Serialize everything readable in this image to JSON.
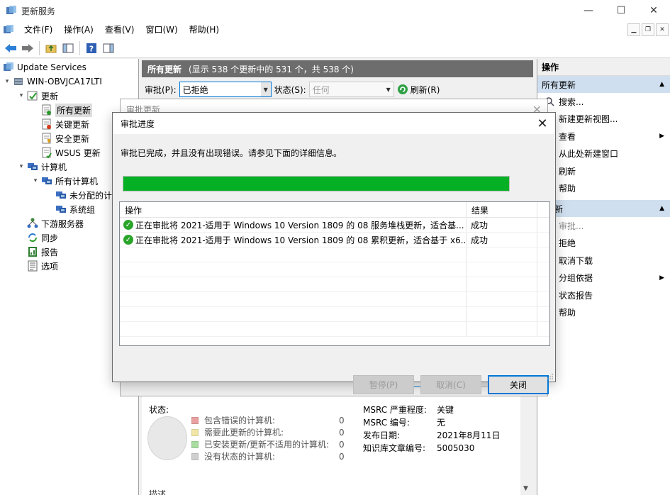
{
  "window": {
    "title": "更新服务"
  },
  "window_buttons": {
    "minimize": "—",
    "maximize": "☐",
    "close": "✕"
  },
  "menu": [
    "文件(F)",
    "操作(A)",
    "查看(V)",
    "窗口(W)",
    "帮助(H)"
  ],
  "tree": {
    "root": "Update Services",
    "server": "WIN-OBVJCA17LTI",
    "updates": "更新",
    "all_updates": "所有更新",
    "critical_updates": "关键更新",
    "security_updates": "安全更新",
    "wsus_updates": "WSUS 更新",
    "computers": "计算机",
    "all_computers": "所有计算机",
    "unassigned": "未分配的计",
    "system_group": "系统组",
    "downstream": "下游服务器",
    "sync": "同步",
    "reports": "报告",
    "options": "选项"
  },
  "center": {
    "header_title": "所有更新",
    "header_count": "(显示 538 个更新中的 531 个，共 538 个)",
    "approval_label": "审批(P):",
    "approval_value": "已拒绝",
    "status_label": "状态(S):",
    "status_value": "任何",
    "refresh_label": "刷新(R)"
  },
  "details": {
    "status_label": "状态:",
    "legend": [
      {
        "label": "包含错误的计算机:",
        "count": "0",
        "color": "#e8a0a0"
      },
      {
        "label": "需要此更新的计算机:",
        "count": "0",
        "color": "#f2e6a6"
      },
      {
        "label": "已安装更新/更新不适用的计算机:",
        "count": "0",
        "color": "#a8dca0"
      },
      {
        "label": "没有状态的计算机:",
        "count": "0",
        "color": "#cfcfcf"
      }
    ],
    "msrc_severity_label": "MSRC 严重程度:",
    "msrc_severity_value": "关键",
    "msrc_number_label": "MSRC 编号:",
    "msrc_number_value": "无",
    "release_date_label": "发布日期:",
    "release_date_value": "2021年8月11日",
    "kb_label": "知识库文章编号:",
    "kb_value": "5005030",
    "description_label": "描述"
  },
  "actions": {
    "header": "操作",
    "section1": "所有更新",
    "section1_items": [
      "搜索...",
      "新建更新视图...",
      "查看",
      "从此处新建窗口",
      "刷新",
      "帮助"
    ],
    "section2": "新",
    "section2_items": [
      "审批...",
      "拒绝",
      "取消下载",
      "分组依据",
      "状态报告",
      "帮助"
    ]
  },
  "bg_dialog": {
    "title": "审批更新"
  },
  "dialog": {
    "title": "审批进度",
    "message": "审批已完成，并且没有出现错误。请参见下面的详细信息。",
    "progress": 1.0,
    "progress_color": "#06b025",
    "col_action": "操作",
    "col_result": "结果",
    "rows": [
      {
        "action": "正在审批将 2021-适用于 Windows 10 Version 1809 的 08 服务堆栈更新，适合基...",
        "result": "成功"
      },
      {
        "action": "正在审批将 2021-适用于 Windows 10 Version 1809 的 08 累积更新，适合基于 x6...",
        "result": "成功"
      }
    ],
    "pause_label": "暂停(P)",
    "cancel_label": "取消(C)",
    "close_label": "关闭"
  }
}
